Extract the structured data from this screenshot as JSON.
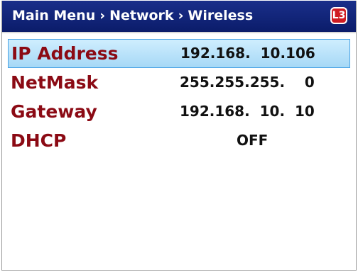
{
  "header": {
    "breadcrumb": [
      "Main Menu",
      "Network",
      "Wireless"
    ],
    "separator": "›",
    "logo_text": "L3"
  },
  "fields": [
    {
      "label": "IP Address",
      "value": "192.168.  10.106",
      "selected": true
    },
    {
      "label": "NetMask",
      "value": "255.255.255.    0",
      "selected": false
    },
    {
      "label": "Gateway",
      "value": "192.168.  10.  10",
      "selected": false
    },
    {
      "label": "DHCP",
      "value": "OFF",
      "selected": false
    }
  ],
  "colors": {
    "titlebar": "#0b1c6a",
    "label": "#8b0a14",
    "selection": "#a6d8f6"
  }
}
